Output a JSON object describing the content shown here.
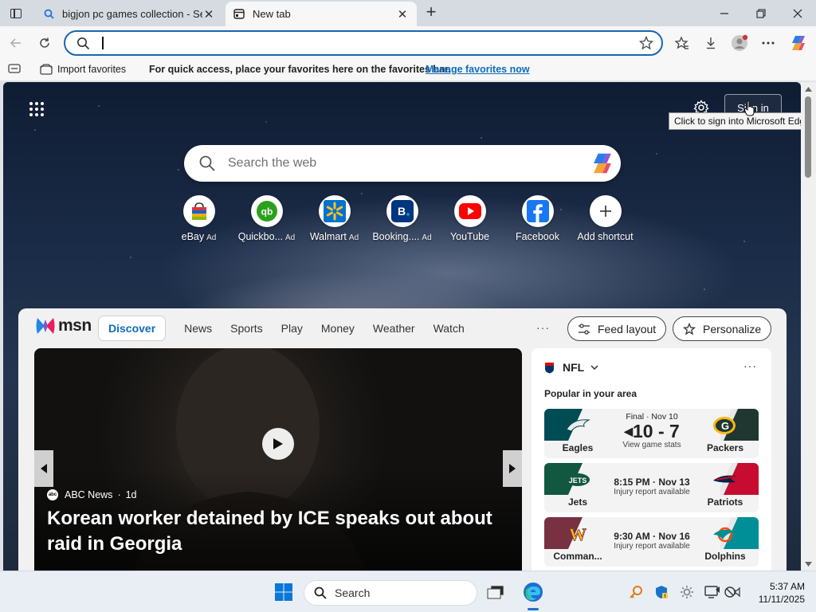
{
  "browser": {
    "tabs": [
      {
        "title": "bigjon pc games collection - Search",
        "active": false
      },
      {
        "title": "New tab",
        "active": true
      }
    ],
    "address_value": "",
    "favorites_bar": {
      "import_label": "Import favorites",
      "message": "For quick access, place your favorites here on the favorites bar.",
      "manage_link": "Manage favorites now"
    }
  },
  "newtab": {
    "signin_label": "Sign in",
    "tooltip": "Click to sign into Microsoft Edge",
    "search_placeholder": "Search the web",
    "shortcuts": [
      {
        "label": "eBay",
        "ad": "Ad",
        "icon": "ebay-bag-icon"
      },
      {
        "label": "Quickbo...",
        "ad": "Ad",
        "icon": "quickbooks-icon"
      },
      {
        "label": "Walmart",
        "ad": "Ad",
        "icon": "walmart-spark-icon"
      },
      {
        "label": "Booking....",
        "ad": "Ad",
        "icon": "booking-icon"
      },
      {
        "label": "YouTube",
        "ad": "",
        "icon": "youtube-icon"
      },
      {
        "label": "Facebook",
        "ad": "",
        "icon": "facebook-icon"
      },
      {
        "label": "Add shortcut",
        "ad": "",
        "icon": "plus-icon"
      }
    ]
  },
  "feed": {
    "logo_text": "msn",
    "nav": [
      "Discover",
      "News",
      "Sports",
      "Play",
      "Money",
      "Weather",
      "Watch"
    ],
    "more": "···",
    "feed_layout_label": "Feed layout",
    "personalize_label": "Personalize",
    "hero": {
      "source": "ABC News",
      "age": "1d",
      "source_logo_text": "abc",
      "headline": "Korean worker detained by ICE speaks out about raid in Georgia"
    },
    "nfl": {
      "title": "NFL",
      "subtitle": "Popular in your area",
      "games": [
        {
          "home": "Eagles",
          "away": "Packers",
          "line1": "Final · Nov 10",
          "score": "10 - 7",
          "line2": "View game stats",
          "kind": "final",
          "color_l": "#004c54",
          "color_r": "#203731"
        },
        {
          "home": "Jets",
          "away": "Patriots",
          "time": "8:15 PM · Nov 13",
          "line2": "Injury report available",
          "kind": "upcoming",
          "color_l": "#125740",
          "color_r": "#c60c30"
        },
        {
          "home": "Comman...",
          "away": "Dolphins",
          "time": "9:30 AM · Nov 16",
          "line2": "Injury report available",
          "kind": "upcoming",
          "color_l": "#773141",
          "color_r": "#008e97"
        }
      ]
    }
  },
  "taskbar": {
    "search_label": "Search",
    "time": "5:37 AM",
    "date": "11/11/2025"
  }
}
